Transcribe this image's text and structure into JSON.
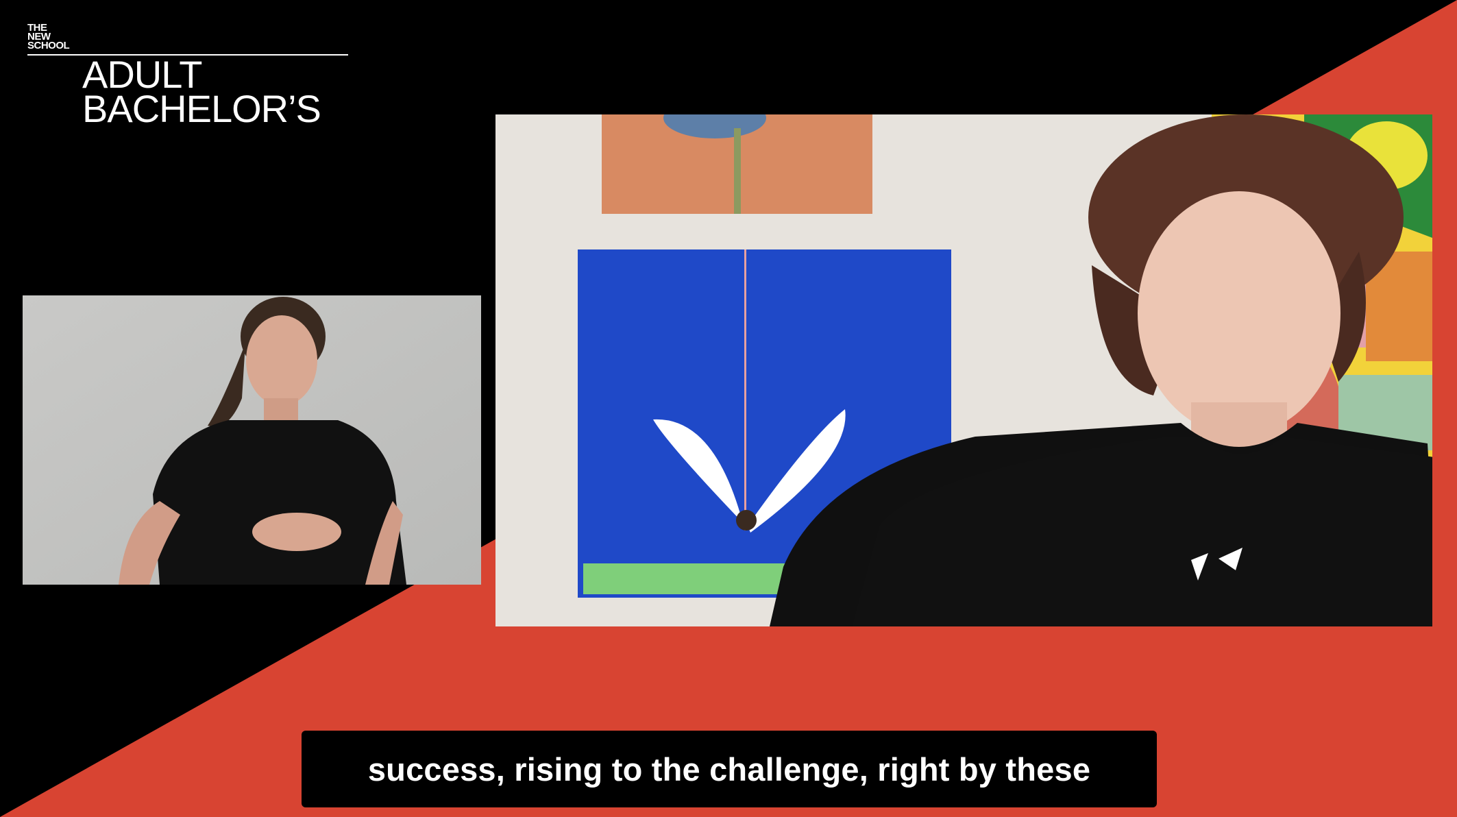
{
  "brand": {
    "small_lines": [
      "THE",
      "NEW",
      "SCHOOL"
    ],
    "title_lines": [
      "ADULT",
      "BACHELOR’S"
    ]
  },
  "colors": {
    "background": "#000000",
    "accent": "#d84432",
    "caption_bg": "#000000",
    "caption_text": "#ffffff"
  },
  "participants": {
    "interpreter_tile": {
      "label": "sign-language interpreter video"
    },
    "speaker_tile": {
      "label": "speaker video"
    }
  },
  "caption": {
    "text": "success, rising to the challenge, right by these"
  }
}
